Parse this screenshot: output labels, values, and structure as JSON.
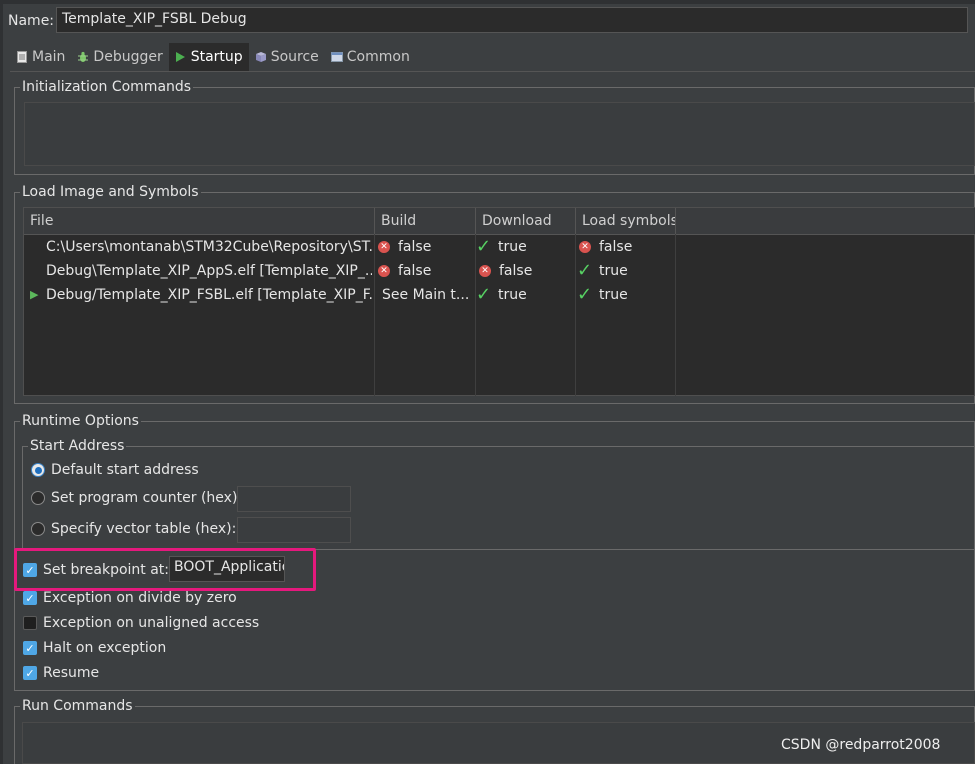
{
  "name": {
    "label": "Name:",
    "value": "Template_XIP_FSBL Debug"
  },
  "tabs": [
    {
      "label": "Main",
      "icon": "page-icon"
    },
    {
      "label": "Debugger",
      "icon": "bug-icon"
    },
    {
      "label": "Startup",
      "icon": "play-icon",
      "active": true
    },
    {
      "label": "Source",
      "icon": "source-icon"
    },
    {
      "label": "Common",
      "icon": "common-icon"
    }
  ],
  "init": {
    "title": "Initialization Commands",
    "value": ""
  },
  "load": {
    "title": "Load Image and Symbols",
    "columns": [
      "File",
      "Build",
      "Download",
      "Load symbols"
    ],
    "rows": [
      {
        "file": "C:\\Users\\montanab\\STM32Cube\\Repository\\ST...",
        "build": "false",
        "build_ok": false,
        "download": "true",
        "download_ok": true,
        "symbols": "false",
        "symbols_ok": false,
        "marker": ""
      },
      {
        "file": "Debug\\Template_XIP_AppS.elf [Template_XIP_...",
        "build": "false",
        "build_ok": false,
        "download": "false",
        "download_ok": false,
        "symbols": "true",
        "symbols_ok": true,
        "marker": ""
      },
      {
        "file": "Debug/Template_XIP_FSBL.elf [Template_XIP_F...",
        "build": "See Main t...",
        "build_ok": null,
        "download": "true",
        "download_ok": true,
        "symbols": "true",
        "symbols_ok": true,
        "marker": "▶"
      }
    ]
  },
  "runtime": {
    "title": "Runtime Options",
    "start_address": {
      "title": "Start Address",
      "options": [
        {
          "label": "Default start address",
          "selected": true
        },
        {
          "label": "Set program counter (hex):",
          "selected": false,
          "value": ""
        },
        {
          "label": "Specify vector table (hex):",
          "selected": false,
          "value": ""
        }
      ]
    },
    "breakpoint": {
      "label": "Set breakpoint at:",
      "checked": true,
      "value": "BOOT_Applicatio"
    },
    "checkboxes": [
      {
        "label": "Exception on divide by zero",
        "checked": true
      },
      {
        "label": "Exception on unaligned access",
        "checked": false
      },
      {
        "label": "Halt on exception",
        "checked": true
      },
      {
        "label": "Resume",
        "checked": true
      }
    ]
  },
  "run": {
    "title": "Run Commands",
    "value": ""
  },
  "watermark": "CSDN @redparrot2008",
  "colors": {
    "background": "#3c3f41",
    "table_bg": "#2b2b2b",
    "highlight": "#e5197d",
    "check_blue": "#4fa7e6",
    "ok_green": "#57d163",
    "error_red": "#d9534f"
  }
}
